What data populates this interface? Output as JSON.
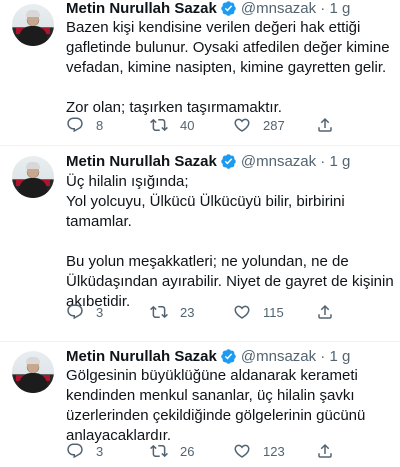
{
  "tweets": [
    {
      "author": "Metin Nurullah Sazak",
      "handle_time": "@mnsazak · 1 g",
      "lines_a": [
        "Bazen kişi kendisine verilen değeri hak ettiği",
        "gafletinde bulunur. Oysaki atfedilen değer kimine",
        "vefadan, kimine nasipten, kimine gayretten gelir."
      ],
      "lines_b": [
        "Zor olan; taşırken taşırmamaktır."
      ],
      "replies": "8",
      "retweets": "40",
      "likes": "287"
    },
    {
      "author": "Metin Nurullah Sazak",
      "handle_time": "@mnsazak · 1 g",
      "lines_a": [
        "Üç hilalin ışığında;",
        "Yol yolcuyu, Ülkücü Ülkücüyü bilir, birbirini",
        "tamamlar."
      ],
      "lines_b": [
        "Bu yolun meşakkatleri; ne yolundan, ne de",
        "Ülküdaşından ayırabilir. Niyet de gayret de kişinin",
        "akıbetidir."
      ],
      "replies": "3",
      "retweets": "23",
      "likes": "115"
    },
    {
      "author": "Metin Nurullah Sazak",
      "handle_time": "@mnsazak · 1 g",
      "lines_a": [
        "Gölgesinin büyüklüğüne aldanarak kerameti",
        "kendinden menkul sananlar, üç hilalin şavkı",
        "üzerlerinden çekildiğinde gölgelerinin gücünü",
        "anlayacaklardır."
      ],
      "lines_b": [],
      "replies": "3",
      "retweets": "26",
      "likes": "123"
    }
  ],
  "icons": {
    "reply": "reply-icon",
    "retweet": "retweet-icon",
    "like": "heart-icon",
    "share": "share-icon",
    "verified": "verified-badge-icon"
  },
  "colors": {
    "text": "#0f1419",
    "secondary": "#536471",
    "verified": "#1d9bf0",
    "divider": "#eff3f4"
  }
}
